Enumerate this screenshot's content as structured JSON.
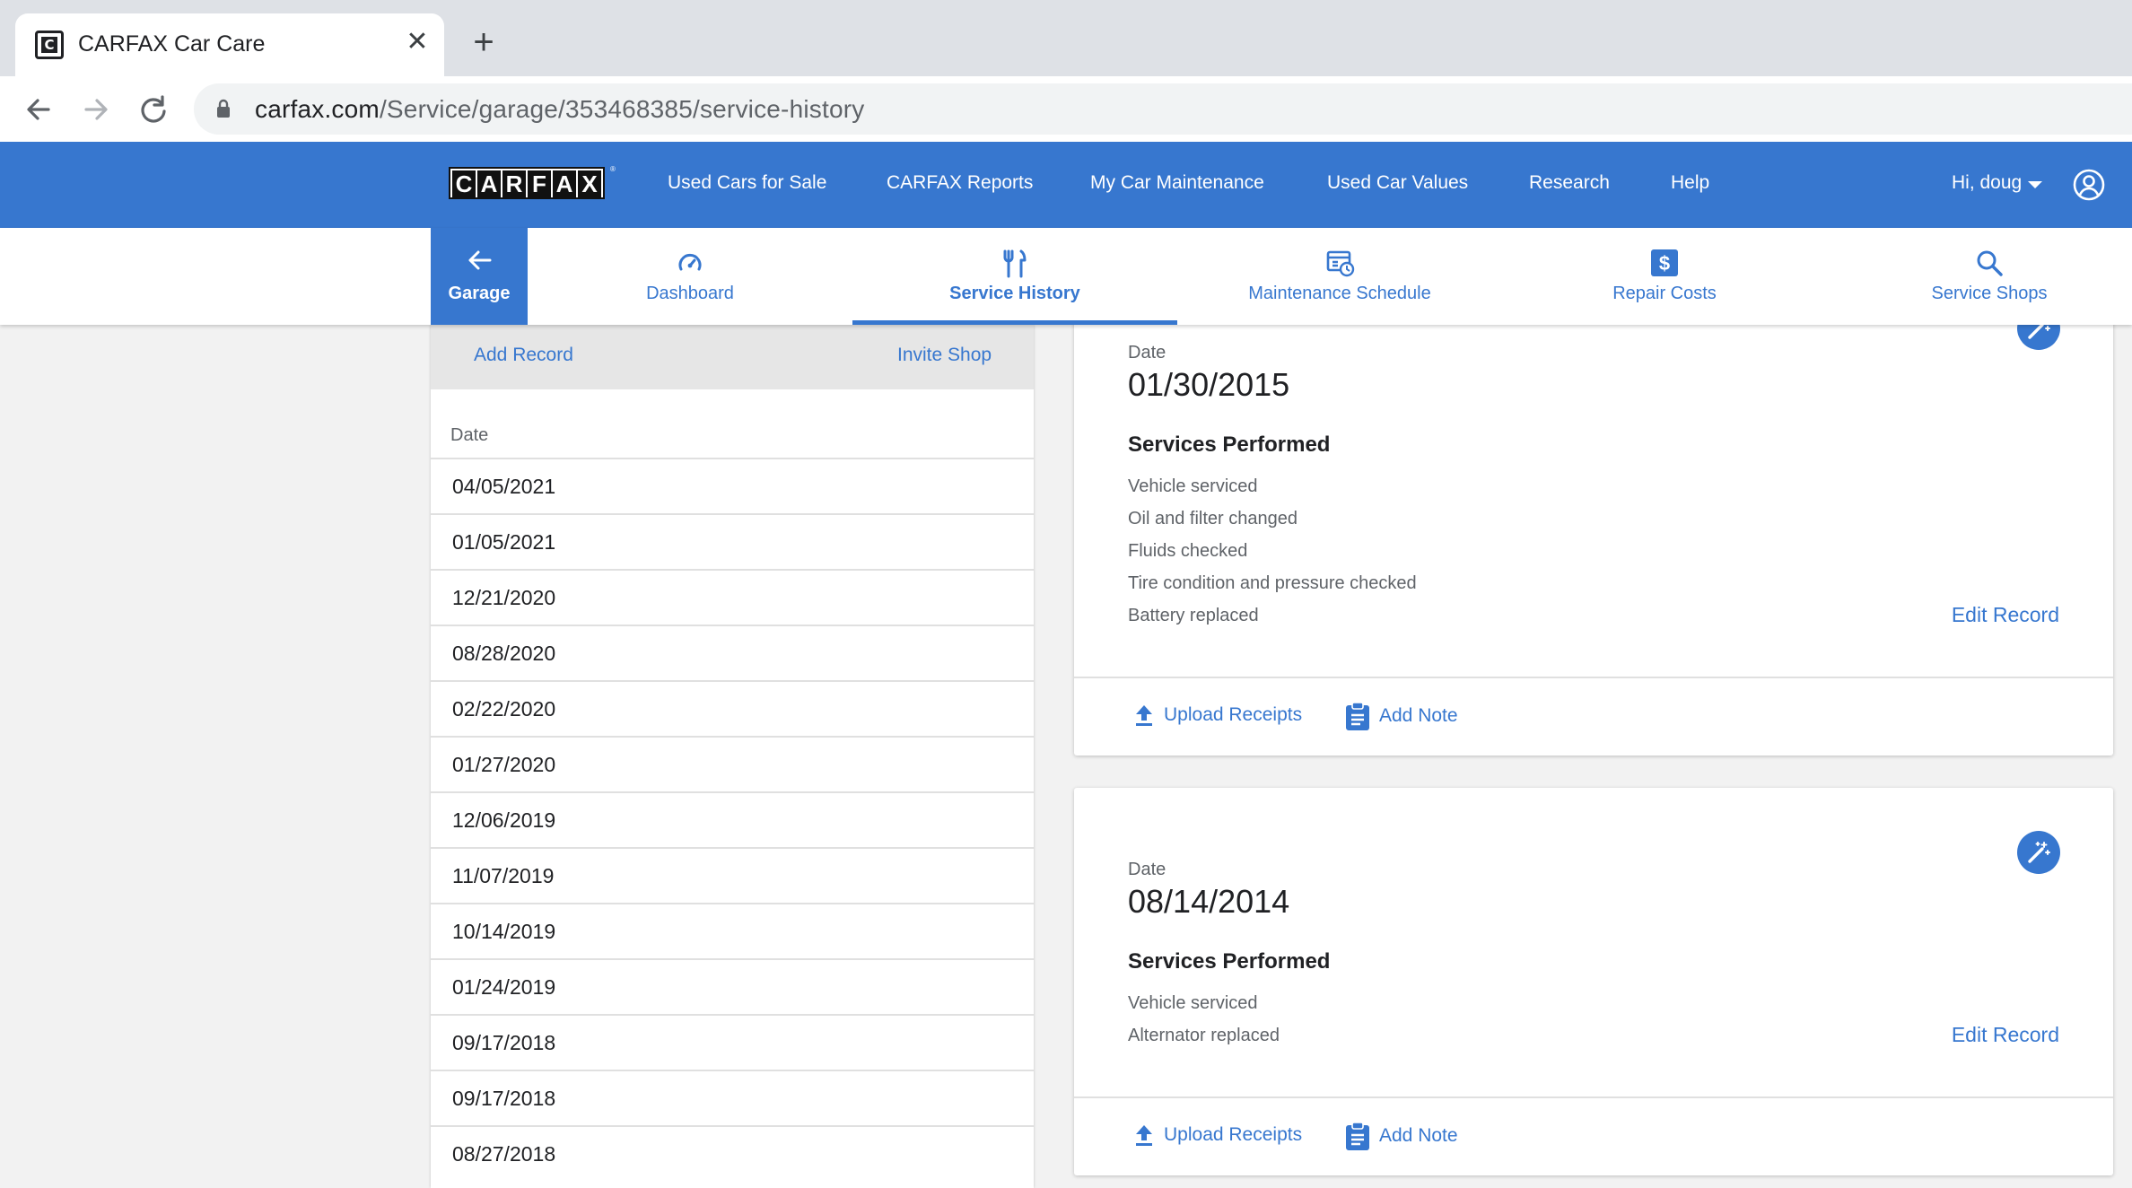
{
  "browser": {
    "tab_title": "CARFAX Car Care",
    "tab_favicon_letter": "C",
    "close_glyph": "✕",
    "new_tab_glyph": "+",
    "url_host": "carfax.com",
    "url_path": "/Service/garage/353468385/service-history"
  },
  "header": {
    "logo_letters": [
      "C",
      "A",
      "R",
      "F",
      "A",
      "X"
    ],
    "logo_reg": "®",
    "nav": [
      {
        "label": "Used Cars for Sale"
      },
      {
        "label": "CARFAX Reports"
      },
      {
        "label": "My Car Maintenance"
      },
      {
        "label": "Used Car Values"
      },
      {
        "label": "Research"
      },
      {
        "label": "Help"
      }
    ],
    "user_greeting": "Hi, doug",
    "brand_color": "#3777cf"
  },
  "subnav": {
    "garage_label": "Garage",
    "items": [
      {
        "label": "Dashboard",
        "icon": "speedometer-icon"
      },
      {
        "label": "Service History",
        "icon": "tools-icon",
        "active": true
      },
      {
        "label": "Maintenance Schedule",
        "icon": "schedule-icon"
      },
      {
        "label": "Repair Costs",
        "icon": "dollar-icon"
      },
      {
        "label": "Service Shops",
        "icon": "search-icon"
      }
    ]
  },
  "list_panel": {
    "add_record": "Add Record",
    "invite_shop": "Invite Shop",
    "column_header": "Date",
    "dates": [
      "04/05/2021",
      "01/05/2021",
      "12/21/2020",
      "08/28/2020",
      "02/22/2020",
      "01/27/2020",
      "12/06/2019",
      "11/07/2019",
      "10/14/2019",
      "01/24/2019",
      "09/17/2018",
      "09/17/2018",
      "08/27/2018"
    ]
  },
  "records": [
    {
      "date_label": "Date",
      "date": "01/30/2015",
      "services_title": "Services Performed",
      "services": [
        "Vehicle serviced",
        "Oil and filter changed",
        "Fluids checked",
        "Tire condition and pressure checked",
        "Battery replaced"
      ],
      "edit_label": "Edit Record",
      "upload_label": "Upload Receipts",
      "note_label": "Add Note"
    },
    {
      "date_label": "Date",
      "date": "08/14/2014",
      "services_title": "Services Performed",
      "services": [
        "Vehicle serviced",
        "Alternator replaced"
      ],
      "edit_label": "Edit Record",
      "upload_label": "Upload Receipts",
      "note_label": "Add Note"
    }
  ]
}
